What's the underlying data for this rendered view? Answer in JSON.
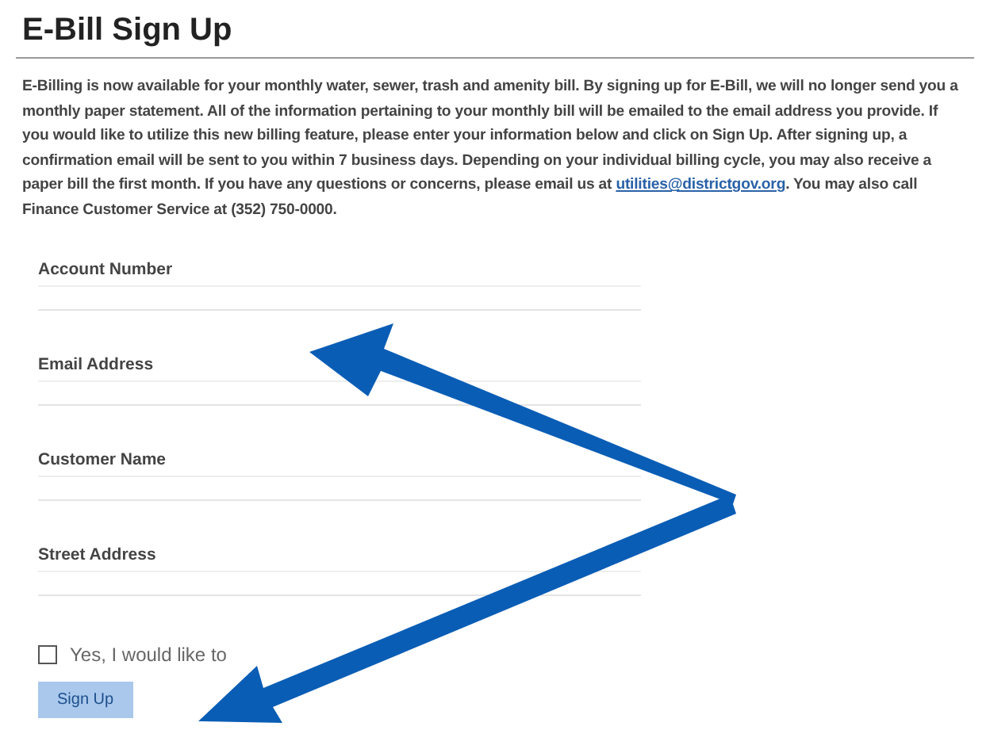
{
  "title": "E-Bill Sign Up",
  "intro": {
    "text_before": "E-Billing is now available for your monthly water, sewer, trash and amenity bill.  By signing up for E-Bill, we will no longer send you a monthly paper statement.  All of the information pertaining to your monthly bill will be emailed to the email address you provide.  If you would like to utilize this new billing feature, please enter your information below and click on Sign Up.  After signing up, a confirmation email will be sent to you within 7 business days.  Depending on your individual billing cycle, you may also receive a paper bill the first month.  If you have any questions or concerns, please email us at",
    "link": "utilities@districtgov.org",
    "text_after": ". You may also call Finance Customer Service at (352) 750-0000."
  },
  "fields": [
    {
      "label": "Account Number"
    },
    {
      "label": "Email Address"
    },
    {
      "label": "Customer Name"
    },
    {
      "label": "Street Address"
    }
  ],
  "checkbox": {
    "label": "Yes, I would like to",
    "checked": false
  },
  "button": "Sign Up"
}
